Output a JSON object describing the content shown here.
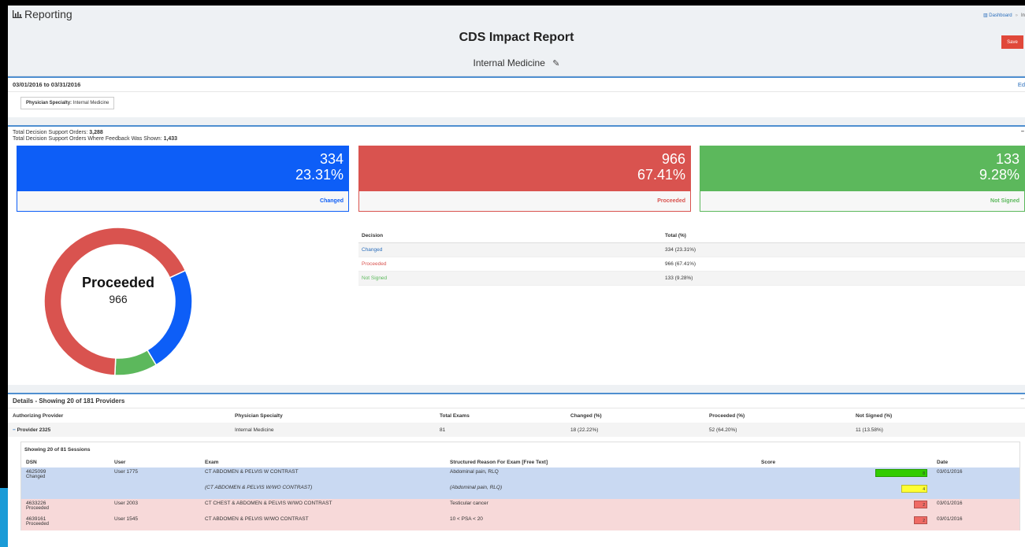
{
  "app": {
    "title": "Reporting",
    "icon": "bar-chart-icon"
  },
  "breadcrumb": {
    "dashboard": "Dashboard",
    "current": "In"
  },
  "report": {
    "title": "CDS Impact Report",
    "subtitle": "Internal Medicine",
    "save_label": "Save"
  },
  "filters": {
    "date_range": "03/01/2016 to 03/31/2016",
    "edit_label": "Ed",
    "specialty_label": "Physician Specialty:",
    "specialty_value": "Internal Medicine"
  },
  "totals": {
    "orders_label": "Total Decision Support Orders:",
    "orders_value": "3,288",
    "feedback_label": "Total Decision Support Orders Where Feedback Was Shown:",
    "feedback_value": "1,433"
  },
  "cards": [
    {
      "count": "334",
      "percent": "23.31%",
      "label": "Changed",
      "color": "#0d5ef7"
    },
    {
      "count": "966",
      "percent": "67.41%",
      "label": "Proceeded",
      "color": "#d9534f"
    },
    {
      "count": "133",
      "percent": "9.28%",
      "label": "Not Signed",
      "color": "#5cb85c"
    }
  ],
  "donut": {
    "label": "Proceeded",
    "value": "966"
  },
  "decision_table": {
    "headers": [
      "Decision",
      "Total (%)"
    ],
    "rows": [
      {
        "decision": "Changed",
        "total": "334 (23.31%)",
        "color": "#2a6ebb"
      },
      {
        "decision": "Proceeded",
        "total": "966 (67.41%)",
        "color": "#d9534f"
      },
      {
        "decision": "Not Signed",
        "total": "133 (9.28%)",
        "color": "#5cb85c"
      }
    ]
  },
  "details": {
    "title": "Details - Showing 20 of 181 Providers",
    "headers": [
      "Authorizing Provider",
      "Physician Specialty",
      "Total Exams",
      "Changed (%)",
      "Proceeded (%)",
      "Not Signed (%)"
    ],
    "provider": {
      "name": "Provider 2325",
      "specialty": "Internal Medicine",
      "total": "81",
      "changed": "18 (22.22%)",
      "proceeded": "52 (64.20%)",
      "not_signed": "11 (13.58%)"
    },
    "sessions_title": "Showing 20 of 81 Sessions",
    "session_headers": [
      "DSN",
      "User",
      "Exam",
      "Structured Reason For Exam [Free Text]",
      "Score",
      "Date"
    ],
    "sessions": [
      {
        "dsn": "4625099",
        "status": "Changed",
        "user": "User 1775",
        "exam": "CT ABDOMEN & PELVIS W CONTRAST",
        "reason": "Abdominal pain, RLQ",
        "score": "8",
        "score_color": "#33cc00",
        "date": "03/01/2016"
      },
      {
        "dsn": "",
        "status": "",
        "user": "",
        "exam": "(CT ABDOMEN & PELVIS W/WO CONTRAST)",
        "reason": "(Abdominal pain, RLQ)",
        "score": "4",
        "score_color": "#ffff33",
        "date": ""
      },
      {
        "dsn": "4633226",
        "status": "Proceeded",
        "user": "User 2003",
        "exam": "CT CHEST & ABDOMEN & PELVIS W/WO CONTRAST",
        "reason": "Testicular cancer",
        "score": "2",
        "score_color": "#ef6a64",
        "date": "03/01/2016"
      },
      {
        "dsn": "4639161",
        "status": "Proceeded",
        "user": "User 1545",
        "exam": "CT ABDOMEN & PELVIS W/WO CONTRAST",
        "reason": "10 < PSA < 20",
        "score": "2",
        "score_color": "#ef6a64",
        "date": "03/01/2016"
      }
    ]
  }
}
